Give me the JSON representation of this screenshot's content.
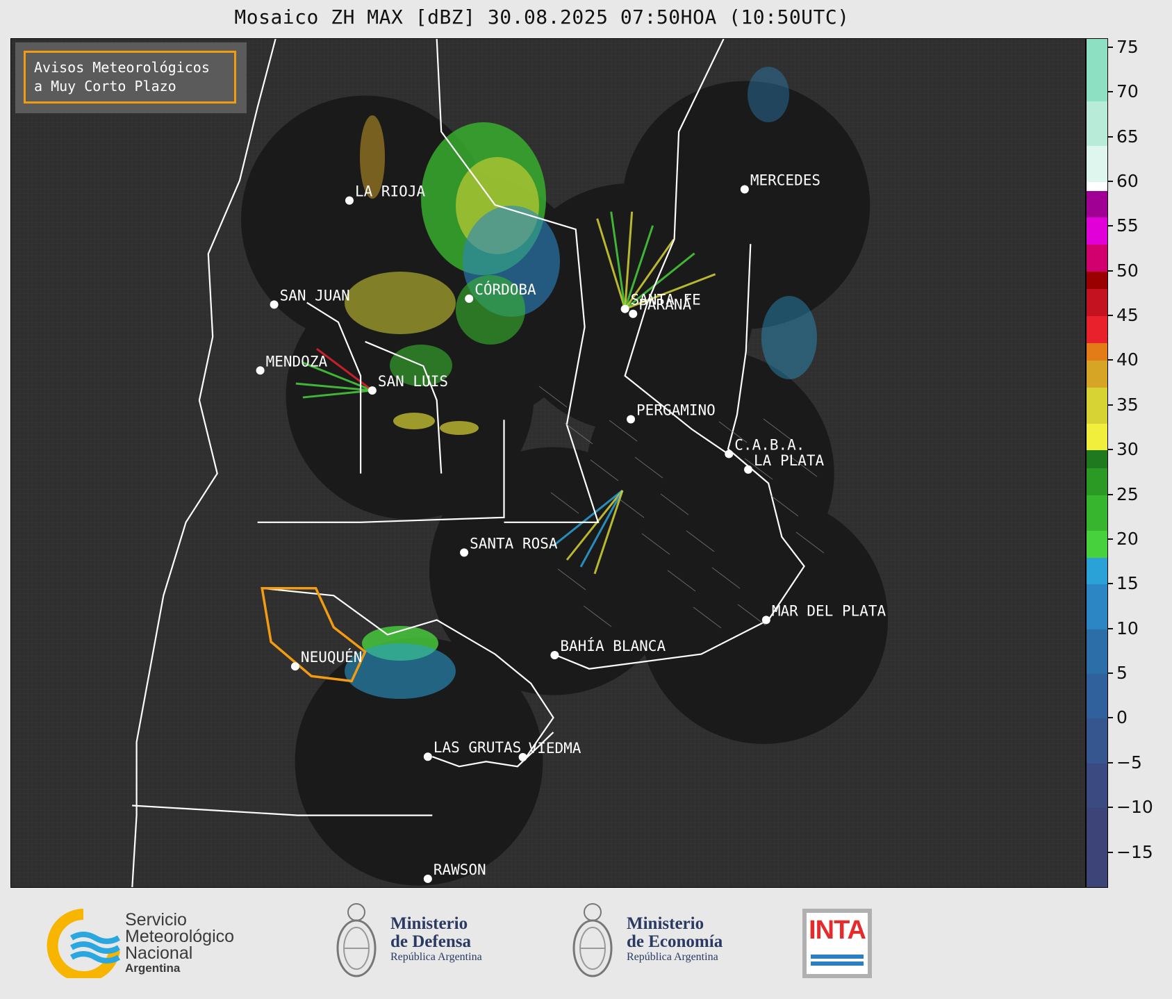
{
  "title": "Mosaico ZH MAX [dBZ] 30.08.2025 07:50HOA (10:50UTC)",
  "alert_box": {
    "line1": "Avisos Meteorológicos",
    "line2": "a Muy Corto Plazo",
    "border_color": "#f39c12"
  },
  "cities": [
    {
      "name": "LA RIOJA",
      "lon": -66.85,
      "lat": -29.41
    },
    {
      "name": "MERCEDES",
      "lon": -58.03,
      "lat": -29.18
    },
    {
      "name": "SAN JUAN",
      "lon": -68.53,
      "lat": -31.54
    },
    {
      "name": "CÓRDOBA",
      "lon": -64.18,
      "lat": -31.42
    },
    {
      "name": "SANTA FE",
      "lon": -60.7,
      "lat": -31.63
    },
    {
      "name": "PARANÁ",
      "lon": -60.52,
      "lat": -31.73
    },
    {
      "name": "MENDOZA",
      "lon": -68.84,
      "lat": -32.89
    },
    {
      "name": "SAN LUIS",
      "lon": -66.34,
      "lat": -33.3
    },
    {
      "name": "PERGAMINO",
      "lon": -60.57,
      "lat": -33.89
    },
    {
      "name": "C.A.B.A.",
      "lon": -58.38,
      "lat": -34.6
    },
    {
      "name": "LA PLATA",
      "lon": -57.95,
      "lat": -34.92
    },
    {
      "name": "SANTA ROSA",
      "lon": -64.29,
      "lat": -36.62
    },
    {
      "name": "MAR DEL PLATA",
      "lon": -57.55,
      "lat": -38.0
    },
    {
      "name": "BAHÍA BLANCA",
      "lon": -62.27,
      "lat": -38.72
    },
    {
      "name": "NEUQUÉN",
      "lon": -68.06,
      "lat": -38.95
    },
    {
      "name": "LAS GRUTAS",
      "lon": -65.1,
      "lat": -40.8
    },
    {
      "name": "VIEDMA",
      "lon": -62.98,
      "lat": -40.81
    },
    {
      "name": "RAWSON",
      "lon": -65.1,
      "lat": -43.3
    }
  ],
  "radars": [
    {
      "lon": -66.5,
      "lat": -29.8,
      "range_km": 240
    },
    {
      "lon": -64.18,
      "lat": -31.42,
      "range_km": 240
    },
    {
      "lon": -60.6,
      "lat": -31.6,
      "range_km": 240
    },
    {
      "lon": -58.0,
      "lat": -29.5,
      "range_km": 240
    },
    {
      "lon": -65.5,
      "lat": -33.4,
      "range_km": 240
    },
    {
      "lon": -58.8,
      "lat": -35.0,
      "range_km": 240
    },
    {
      "lon": -57.6,
      "lat": -38.0,
      "range_km": 240
    },
    {
      "lon": -62.3,
      "lat": -37.0,
      "range_km": 240
    },
    {
      "lon": -65.3,
      "lat": -40.9,
      "range_km": 240
    }
  ],
  "warning_polygon": {
    "color": "#f39c12",
    "points": [
      [
        -68.8,
        -37.35
      ],
      [
        -67.6,
        -37.35
      ],
      [
        -67.2,
        -38.15
      ],
      [
        -66.5,
        -38.65
      ],
      [
        -66.8,
        -39.25
      ],
      [
        -67.7,
        -39.15
      ],
      [
        -68.6,
        -38.45
      ]
    ]
  },
  "colorbar": {
    "vmin": -19,
    "vmax": 76,
    "ticks": [
      75,
      70,
      65,
      60,
      55,
      50,
      45,
      40,
      35,
      30,
      25,
      20,
      15,
      10,
      5,
      0,
      -5,
      -10,
      -15
    ],
    "tick_labels": [
      "75",
      "70",
      "65",
      "60",
      "55",
      "50",
      "45",
      "40",
      "35",
      "30",
      "25",
      "20",
      "15",
      "10",
      "5",
      "0",
      "−5",
      "−10",
      "−15"
    ],
    "segments": [
      {
        "from": -19,
        "to": -10,
        "color": "#3c4478"
      },
      {
        "from": -10,
        "to": -5,
        "color": "#3b4b82"
      },
      {
        "from": -5,
        "to": 0,
        "color": "#35568f"
      },
      {
        "from": 0,
        "to": 5,
        "color": "#30619c"
      },
      {
        "from": 5,
        "to": 10,
        "color": "#2c6fa8"
      },
      {
        "from": 10,
        "to": 15,
        "color": "#2b86c3"
      },
      {
        "from": 15,
        "to": 18,
        "color": "#2aa2d8"
      },
      {
        "from": 18,
        "to": 21,
        "color": "#47d13c"
      },
      {
        "from": 21,
        "to": 25,
        "color": "#38b52e"
      },
      {
        "from": 25,
        "to": 28,
        "color": "#2b9a25"
      },
      {
        "from": 28,
        "to": 30,
        "color": "#1f7a1f"
      },
      {
        "from": 30,
        "to": 33,
        "color": "#f1ef3b"
      },
      {
        "from": 33,
        "to": 37,
        "color": "#d7d335"
      },
      {
        "from": 37,
        "to": 40,
        "color": "#d6a526"
      },
      {
        "from": 40,
        "to": 42,
        "color": "#e37b17"
      },
      {
        "from": 42,
        "to": 45,
        "color": "#e8212d"
      },
      {
        "from": 45,
        "to": 48,
        "color": "#c51221"
      },
      {
        "from": 48,
        "to": 50,
        "color": "#9a0000"
      },
      {
        "from": 50,
        "to": 53,
        "color": "#d1006e"
      },
      {
        "from": 53,
        "to": 56,
        "color": "#e100d8"
      },
      {
        "from": 56,
        "to": 59,
        "color": "#a00094"
      },
      {
        "from": 59,
        "to": 60,
        "color": "#ffffff"
      },
      {
        "from": 60,
        "to": 64,
        "color": "#dff6ee"
      },
      {
        "from": 64,
        "to": 69,
        "color": "#b8ecd9"
      },
      {
        "from": 69,
        "to": 76,
        "color": "#8de0c2"
      }
    ]
  },
  "logos": {
    "smn": {
      "line1": "Servicio",
      "line2": "Meteorológico",
      "line3": "Nacional",
      "line4": "Argentina"
    },
    "defensa": {
      "line1": "Ministerio",
      "line2": "de Defensa",
      "line3": "República Argentina"
    },
    "economia": {
      "line1": "Ministerio",
      "line2": "de Economía",
      "line3": "República Argentina"
    },
    "inta": {
      "text": "INTA"
    }
  },
  "colors": {
    "map_background": "#2e2e2e",
    "radar_coverage": "#1a1a1a",
    "border_white": "#ffffff",
    "border_grey": "#8a8a8a"
  }
}
